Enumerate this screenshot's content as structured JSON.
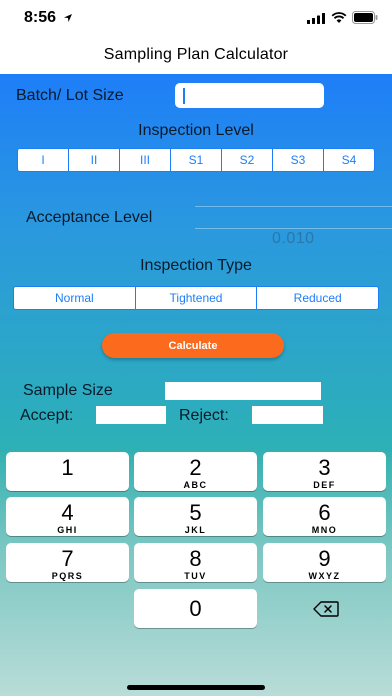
{
  "status": {
    "time": "8:56"
  },
  "nav": {
    "title": "Sampling Plan Calculator"
  },
  "form": {
    "batch_label": "Batch/ Lot Size",
    "batch_value": "",
    "inspection_level_label": "Inspection Level",
    "inspection_levels": [
      "I",
      "II",
      "III",
      "S1",
      "S2",
      "S3",
      "S4"
    ],
    "acceptance_level_label": "Acceptance Level",
    "acceptance_level_value": "0.010",
    "inspection_type_label": "Inspection Type",
    "inspection_types": [
      "Normal",
      "Tightened",
      "Reduced"
    ],
    "calculate_label": "Calculate",
    "sample_size_label": "Sample Size",
    "accept_label": "Accept:",
    "reject_label": "Reject:"
  },
  "keyboard": {
    "keys": [
      {
        "num": "1",
        "letters": ""
      },
      {
        "num": "2",
        "letters": "ABC"
      },
      {
        "num": "3",
        "letters": "DEF"
      },
      {
        "num": "4",
        "letters": "GHI"
      },
      {
        "num": "5",
        "letters": "JKL"
      },
      {
        "num": "6",
        "letters": "MNO"
      },
      {
        "num": "7",
        "letters": "PQRS"
      },
      {
        "num": "8",
        "letters": "TUV"
      },
      {
        "num": "9",
        "letters": "WXYZ"
      },
      {
        "num": "0",
        "letters": ""
      }
    ]
  }
}
